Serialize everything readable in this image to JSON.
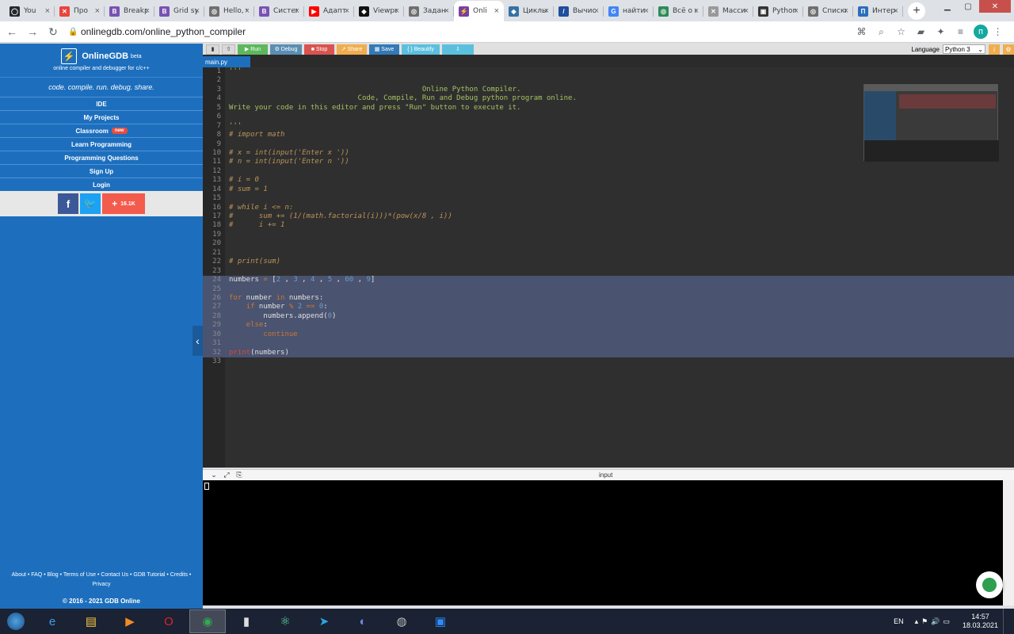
{
  "browser": {
    "tabs": [
      {
        "label": "You",
        "icon": "github-icon",
        "color": "#24292e",
        "glyph": "◯",
        "active": false
      },
      {
        "label": "Про",
        "icon": "tool-icon",
        "color": "#e8453c",
        "glyph": "✕",
        "active": false
      },
      {
        "label": "Breakp",
        "icon": "bootstrap-icon",
        "color": "#7952b3",
        "glyph": "B",
        "active": false
      },
      {
        "label": "Grid sys",
        "icon": "bootstrap-icon",
        "color": "#7952b3",
        "glyph": "B",
        "active": false
      },
      {
        "label": "Hello, w",
        "icon": "globe-icon",
        "color": "#6f6f6f",
        "glyph": "◎",
        "active": false
      },
      {
        "label": "Систем",
        "icon": "bootstrap-icon",
        "color": "#7952b3",
        "glyph": "B",
        "active": false
      },
      {
        "label": "Адапти",
        "icon": "youtube-icon",
        "color": "#ff0000",
        "glyph": "▶",
        "active": false
      },
      {
        "label": "Viewpo",
        "icon": "codepen-icon",
        "color": "#111111",
        "glyph": "◆",
        "active": false
      },
      {
        "label": "Задан",
        "icon": "globe-icon",
        "color": "#6f6f6f",
        "glyph": "◎",
        "active": false
      },
      {
        "label": "Onli",
        "icon": "onlinegdb-icon",
        "color": "#7b3fa0",
        "glyph": "⚡",
        "active": true
      },
      {
        "label": "Циклы",
        "icon": "python-icon",
        "color": "#3572a5",
        "glyph": "◆",
        "active": false
      },
      {
        "label": "Вычисл",
        "icon": "doc-icon",
        "color": "#1f4e9c",
        "glyph": "/",
        "active": false
      },
      {
        "label": "найти в",
        "icon": "google-icon",
        "color": "#4285f4",
        "glyph": "G",
        "active": false
      },
      {
        "label": "Всё о с",
        "icon": "globe-icon",
        "color": "#2e8b57",
        "glyph": "◎",
        "active": false
      },
      {
        "label": "Массив",
        "icon": "tool-icon",
        "color": "#999999",
        "glyph": "✕",
        "active": false
      },
      {
        "label": "Python",
        "icon": "site-icon",
        "color": "#333333",
        "glyph": "▣",
        "active": false
      },
      {
        "label": "Списки",
        "icon": "globe-icon",
        "color": "#6f6f6f",
        "glyph": "◎",
        "active": false
      },
      {
        "label": "Интера",
        "icon": "doc-icon",
        "color": "#2a6ebb",
        "glyph": "П",
        "active": false
      }
    ],
    "url": "onlinegdb.com/online_python_compiler",
    "profile_initial": "п"
  },
  "sidebar": {
    "brand": "OnlineGDB",
    "beta": "beta",
    "subtitle": "online compiler and debugger for c/c++",
    "tagline": "code. compile. run. debug. share.",
    "nav": [
      {
        "label": "IDE"
      },
      {
        "label": "My Projects"
      },
      {
        "label": "Classroom",
        "badge": "new"
      },
      {
        "label": "Learn Programming"
      },
      {
        "label": "Programming Questions"
      },
      {
        "label": "Sign Up"
      },
      {
        "label": "Login"
      }
    ],
    "share_count": "16.1K",
    "footer": "About • FAQ • Blog • Terms of Use • Contact Us • GDB Tutorial • Credits • Privacy",
    "copyright": "© 2016 - 2021 GDB Online"
  },
  "toolbar": {
    "run": "Run",
    "debug": "Debug",
    "stop": "Stop",
    "share": "Share",
    "save": "Save",
    "beautify": "{ } Beautify",
    "language_label": "Language",
    "language_value": "Python 3"
  },
  "editor": {
    "file_tab": "main.py",
    "lines": [
      [
        [
          "t-str",
          "'''"
        ]
      ],
      [],
      [
        [
          "t-str",
          "                                             Online Python Compiler."
        ]
      ],
      [
        [
          "t-str",
          "                              Code, Compile, Run and Debug python program online."
        ]
      ],
      [
        [
          "t-str",
          "Write your code in this editor and press \"Run\" button to execute it."
        ]
      ],
      [],
      [
        [
          "t-str",
          "'''"
        ]
      ],
      [
        [
          "t-com",
          "# import math"
        ]
      ],
      [],
      [
        [
          "t-com",
          "# x = int(input('Enter x '))"
        ]
      ],
      [
        [
          "t-com",
          "# n = int(input('Enter n '))"
        ]
      ],
      [],
      [
        [
          "t-com",
          "# i = 0"
        ]
      ],
      [
        [
          "t-com",
          "# sum = 1"
        ]
      ],
      [],
      [
        [
          "t-com",
          "# while i <= n:"
        ]
      ],
      [
        [
          "t-com",
          "#      sum += (1/(math.factorial(i)))*(pow(x/8 , i))"
        ]
      ],
      [
        [
          "t-com",
          "#      i += 1"
        ]
      ],
      [],
      [],
      [],
      [
        [
          "t-com",
          "# print(sum)"
        ]
      ],
      [],
      [
        [
          "t-id",
          "numbers"
        ],
        [
          "t-kw",
          " = "
        ],
        [
          "t-id",
          "["
        ],
        [
          "t-num",
          "2"
        ],
        [
          "t-id",
          " , "
        ],
        [
          "t-num",
          "3"
        ],
        [
          "t-id",
          " , "
        ],
        [
          "t-num",
          "4"
        ],
        [
          "t-id",
          " , "
        ],
        [
          "t-num",
          "5"
        ],
        [
          "t-id",
          " , "
        ],
        [
          "t-num",
          "60"
        ],
        [
          "t-id",
          " , "
        ],
        [
          "t-num",
          "9"
        ],
        [
          "t-id",
          "]"
        ]
      ],
      [],
      [
        [
          "t-kw",
          "for"
        ],
        [
          "t-id",
          " number "
        ],
        [
          "t-kw",
          "in"
        ],
        [
          "t-id",
          " numbers:"
        ]
      ],
      [
        [
          "t-kw",
          "    if"
        ],
        [
          "t-id",
          " number "
        ],
        [
          "t-kw",
          "%"
        ],
        [
          "t-num",
          " 2"
        ],
        [
          "t-kw",
          " == "
        ],
        [
          "t-num",
          "0"
        ],
        [
          "t-id",
          ":"
        ]
      ],
      [
        [
          "t-id",
          "        numbers.append("
        ],
        [
          "t-num",
          "0"
        ],
        [
          "t-id",
          ")"
        ]
      ],
      [
        [
          "t-kw",
          "    else"
        ],
        [
          "t-id",
          ":"
        ]
      ],
      [
        [
          "t-kw",
          "        continue"
        ]
      ],
      [],
      [
        [
          "t-fn",
          "print"
        ],
        [
          "t-id",
          "(numbers)"
        ]
      ],
      []
    ],
    "highlight_from": 24,
    "highlight_to": 32
  },
  "console": {
    "title": "input"
  },
  "taskbar": {
    "apps": [
      {
        "name": "ie-icon",
        "glyph": "e",
        "color": "#3aa0e8",
        "active": false
      },
      {
        "name": "file-explorer-icon",
        "glyph": "▤",
        "color": "#f5c542",
        "active": false
      },
      {
        "name": "media-player-icon",
        "glyph": "▶",
        "color": "#f08a24",
        "active": false
      },
      {
        "name": "opera-icon",
        "glyph": "O",
        "color": "#e0222c",
        "active": false
      },
      {
        "name": "chrome-icon",
        "glyph": "◉",
        "color": "#34a853",
        "active": true
      },
      {
        "name": "terminal-icon",
        "glyph": "▮",
        "color": "#dddddd",
        "active": false
      },
      {
        "name": "atom-icon",
        "glyph": "⚛",
        "color": "#66d9a0",
        "active": false
      },
      {
        "name": "telegram-icon",
        "glyph": "➤",
        "color": "#2ca5e0",
        "active": false
      },
      {
        "name": "discord-icon",
        "glyph": "◐",
        "color": "#7289da",
        "active": false
      },
      {
        "name": "disk-icon",
        "glyph": "◍",
        "color": "#bbbbbb",
        "active": false
      },
      {
        "name": "zoom-icon",
        "glyph": "▣",
        "color": "#2d8cff",
        "active": false
      }
    ],
    "lang": "EN",
    "time": "14:57",
    "date": "18.03.2021"
  }
}
